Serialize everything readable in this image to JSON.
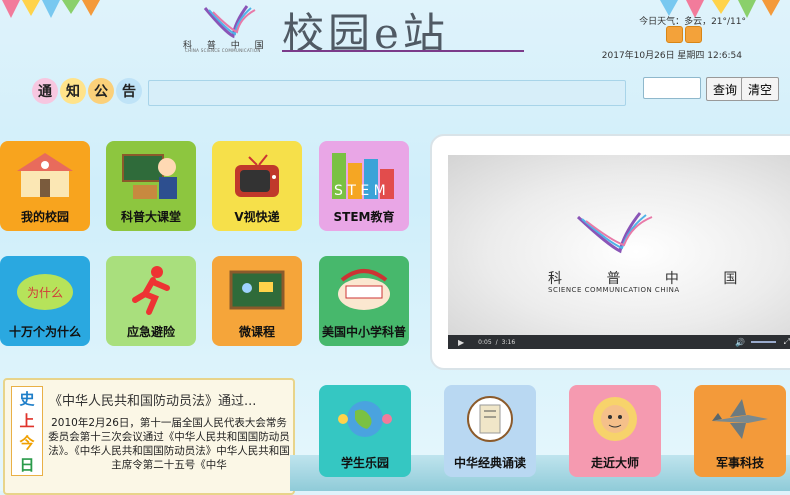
{
  "header": {
    "logo_cn": "科 普 中 国",
    "logo_en": "CHINA SCIENCE COMMUNICATION",
    "site_title": "校园e站",
    "weather": "今日天气：多云，21°/11°",
    "weather_icons": [
      "cloudy-sun-icon",
      "cloudy-sun-icon"
    ],
    "datetime": "2017年10月26日 星期四 12:6:54"
  },
  "notice": {
    "chars": [
      "通",
      "知",
      "公",
      "告"
    ],
    "query_label": "查询",
    "clear_label": "清空"
  },
  "tiles": [
    {
      "label": "我的校园",
      "color": "#f8a41e",
      "icon": "school-building-icon"
    },
    {
      "label": "科普大课堂",
      "color": "#8dc63f",
      "icon": "teacher-blackboard-icon"
    },
    {
      "label": "V视快递",
      "color": "#f6e04a",
      "icon": "retro-tv-icon"
    },
    {
      "label": "STEM教育",
      "color": "#e9a6e6",
      "icon": "stem-blocks-icon"
    },
    {
      "label": "十万个为什么",
      "color": "#2aa8e0",
      "icon": "question-cloud-icon"
    },
    {
      "label": "应急避险",
      "color": "#a9df7d",
      "icon": "running-man-icon"
    },
    {
      "label": "微课程",
      "color": "#f5a53a",
      "icon": "chalkboard-icon"
    },
    {
      "label": "美国中小学科普",
      "color": "#47b86c",
      "icon": "science-hat-icon"
    }
  ],
  "video": {
    "logo_cn": "科 普 中 国",
    "logo_en": "SCIENCE COMMUNICATION CHINA",
    "time_current": "0:05",
    "time_total": "3:16"
  },
  "history": {
    "badge": [
      "史",
      "上",
      "今",
      "日"
    ],
    "title": "《中华人民共和国防动员法》通过...",
    "body": "2010年2月26日，第十一届全国人民代表大会常务委员会第十三次会议通过《中华人民共和国国防动员法》。《中华人民共和国国防动员法》中华人民共和国主席令第二十五号《中华"
  },
  "bottom_tiles": [
    {
      "label": "学生乐园",
      "color": "#35c7c2",
      "icon": "globe-kids-icon"
    },
    {
      "label": "中华经典诵读",
      "color": "#b9d8f2",
      "icon": "classic-book-icon"
    },
    {
      "label": "走近大师",
      "color": "#f59ab0",
      "icon": "master-portrait-icon"
    },
    {
      "label": "军事科技",
      "color": "#f39a3a",
      "icon": "fighter-jet-icon"
    }
  ]
}
